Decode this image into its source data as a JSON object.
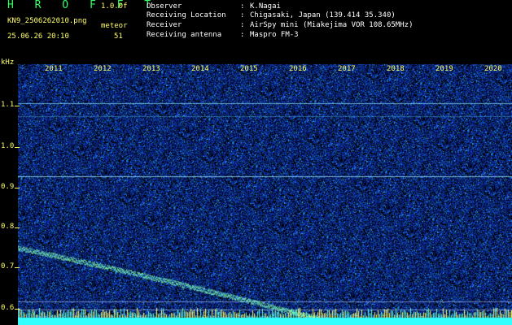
{
  "header": {
    "brand": "H R O F F T",
    "version": "1.0.0f",
    "filename": "KN9_2506262010.png",
    "meteor_label": "meteor",
    "timestamp": "25.06.26 20:10",
    "meteor_count": "51"
  },
  "info": [
    {
      "key": "Observer",
      "sep": ":",
      "value": "K.Nagai"
    },
    {
      "key": "Receiving Location",
      "sep": ":",
      "value": "Chigasaki, Japan (139.414 35.340)"
    },
    {
      "key": "Receiver",
      "sep": ":",
      "value": "AirSpy mini (Miakejima VOR 108.65MHz)"
    },
    {
      "key": "Receiving antenna",
      "sep": ":",
      "value": "Maspro FM-3"
    }
  ],
  "axis": {
    "y_unit": "kHz",
    "y_ticks": [
      "1.1",
      "1.0",
      "0.9",
      "0.8",
      "0.7",
      "0.6"
    ],
    "x_ticks": [
      "2011",
      "2012",
      "2013",
      "2014",
      "2015",
      "2016",
      "2017",
      "2018",
      "2019",
      "2020"
    ]
  },
  "colors": {
    "background": "#000000",
    "noise": "#1a2a9a",
    "signal": "#33ffcc",
    "axis_text": "#ffff66"
  }
}
